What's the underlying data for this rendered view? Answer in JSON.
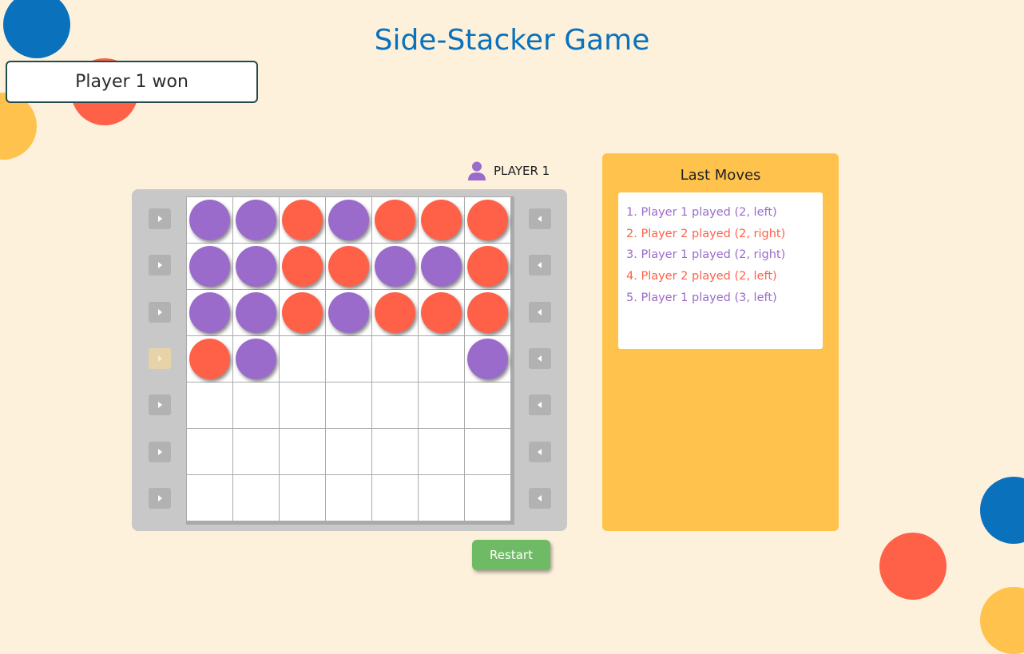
{
  "title": "Side-Stacker Game",
  "status": "Player 1 won",
  "current_player": {
    "label": "PLAYER 1",
    "icon": "user-icon",
    "color": "#9a6bca"
  },
  "colors": {
    "player1": "#9a6bca",
    "player2": "#ff6048",
    "background": "#fdf1dc",
    "panel": "#ffc24d",
    "restart": "#6fbb65",
    "title": "#0a72bd"
  },
  "board": [
    [
      1,
      1,
      2,
      1,
      2,
      2,
      2
    ],
    [
      1,
      1,
      2,
      2,
      1,
      1,
      2
    ],
    [
      1,
      1,
      2,
      1,
      2,
      2,
      2
    ],
    [
      2,
      1,
      0,
      0,
      0,
      0,
      1
    ],
    [
      0,
      0,
      0,
      0,
      0,
      0,
      0
    ],
    [
      0,
      0,
      0,
      0,
      0,
      0,
      0
    ],
    [
      0,
      0,
      0,
      0,
      0,
      0,
      0
    ]
  ],
  "left_buttons": [
    {
      "icon": "arrow-right-icon",
      "enabled": true
    },
    {
      "icon": "arrow-right-icon",
      "enabled": true
    },
    {
      "icon": "arrow-right-icon",
      "enabled": true
    },
    {
      "icon": "arrow-right-icon",
      "enabled": false
    },
    {
      "icon": "arrow-right-icon",
      "enabled": true
    },
    {
      "icon": "arrow-right-icon",
      "enabled": true
    },
    {
      "icon": "arrow-right-icon",
      "enabled": true
    }
  ],
  "right_buttons": [
    {
      "icon": "arrow-left-icon",
      "enabled": true
    },
    {
      "icon": "arrow-left-icon",
      "enabled": true
    },
    {
      "icon": "arrow-left-icon",
      "enabled": true
    },
    {
      "icon": "arrow-left-icon",
      "enabled": true
    },
    {
      "icon": "arrow-left-icon",
      "enabled": true
    },
    {
      "icon": "arrow-left-icon",
      "enabled": true
    },
    {
      "icon": "arrow-left-icon",
      "enabled": true
    }
  ],
  "restart_label": "Restart",
  "last_moves": {
    "title": "Last Moves",
    "items": [
      {
        "text": "1. Player 1 played (2, left)",
        "player": 1
      },
      {
        "text": "2. Player 2 played (2, right)",
        "player": 2
      },
      {
        "text": "3. Player 1 played (2, right)",
        "player": 1
      },
      {
        "text": "4. Player 2 played (2, left)",
        "player": 2
      },
      {
        "text": "5. Player 1 played (3, left)",
        "player": 1
      }
    ]
  }
}
